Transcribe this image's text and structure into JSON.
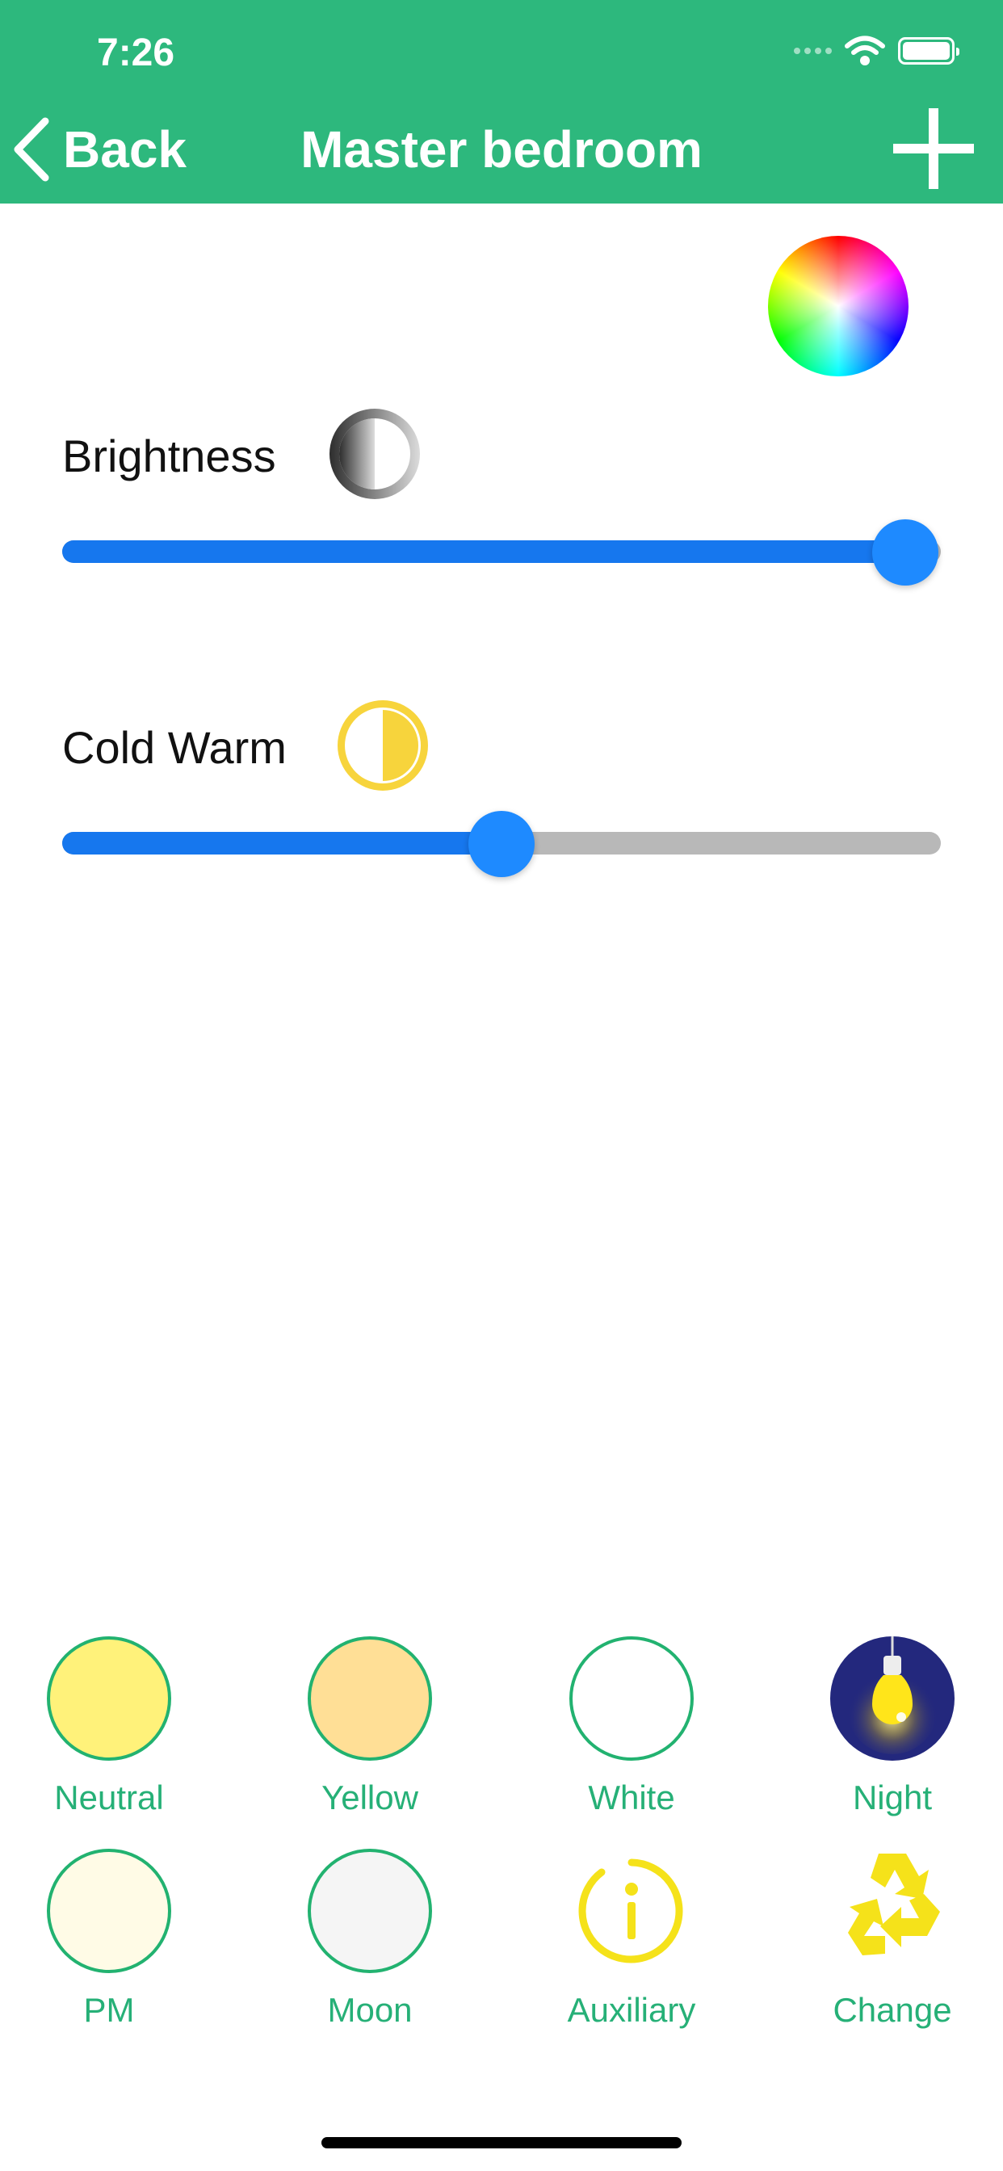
{
  "status_bar": {
    "time": "7:26"
  },
  "nav": {
    "back_label": "Back",
    "title": "Master bedroom",
    "back_icon": "chevron-left",
    "add_icon": "plus"
  },
  "controls": {
    "color_picker_icon": "color-wheel",
    "brightness": {
      "label": "Brightness",
      "icon": "half-contrast-gray",
      "value_percent": 96
    },
    "cold_warm": {
      "label": "Cold Warm",
      "icon": "half-circle-yellow",
      "value_percent": 50
    }
  },
  "presets": [
    {
      "label": "Neutral",
      "color": "#fff27a",
      "icon": "circle"
    },
    {
      "label": "Yellow",
      "color": "#ffdf96",
      "icon": "circle"
    },
    {
      "label": "White",
      "color": "#ffffff",
      "icon": "circle"
    },
    {
      "label": "Night",
      "color": "#23287d",
      "icon": "light-bulb"
    },
    {
      "label": "PM",
      "color": "#fffbe6",
      "icon": "circle"
    },
    {
      "label": "Moon",
      "color": "#f5f5f5",
      "icon": "circle"
    },
    {
      "label": "Auxiliary",
      "color": "#f5e21a",
      "icon": "info"
    },
    {
      "label": "Change",
      "color": "#f5e21a",
      "icon": "recycle"
    }
  ],
  "theme": {
    "accent": "#2db87d",
    "slider_blue": "#1e8aff",
    "label_green": "#26b077"
  }
}
